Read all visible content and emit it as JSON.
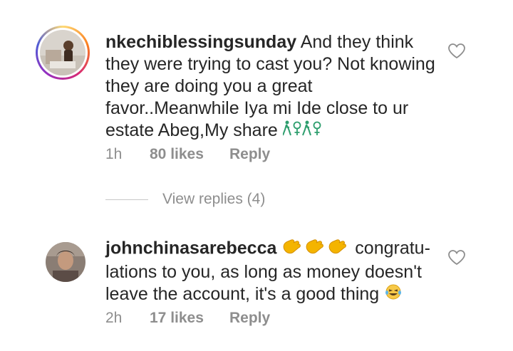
{
  "comments": [
    {
      "username": "nkechiblessingsunday",
      "text": "And they think they were trying to cast you? Not knowing they are doing you a great favor..Meanwhile Iya mi Ide close to ur estate Abeg,My share",
      "trailing_emoji": "🏃‍♀️🏃‍♀️",
      "time": "1h",
      "likes": "80 likes",
      "reply_label": "Reply",
      "avatar_icon": "profile-photo-icon",
      "like_icon": "heart-outline-icon"
    },
    {
      "username": "johnchinasarebecca",
      "leading_emoji": "👏👏👏",
      "text": "congratu-lations to you, as long as money doesn't leave the account, it's a good thing",
      "trailing_emoji": "😂",
      "time": "2h",
      "likes": "17 likes",
      "reply_label": "Reply",
      "avatar_icon": "profile-photo-icon",
      "like_icon": "heart-outline-icon"
    }
  ],
  "view_replies": {
    "label": "View replies (4)"
  },
  "colors": {
    "text": "#262626",
    "secondary": "#8e8e8e",
    "divider": "#c7c7c7",
    "story_ring": [
      "#feda75",
      "#fa7e1e",
      "#d62976",
      "#962fbf",
      "#4f5bd5"
    ]
  }
}
